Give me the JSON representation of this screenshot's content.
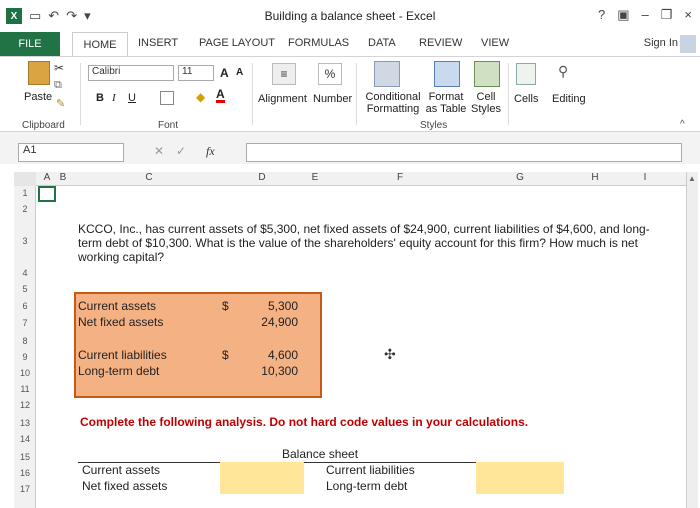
{
  "title": "Building a balance sheet - Excel",
  "window_controls": [
    "?",
    "–",
    "×"
  ],
  "tabs": [
    "FILE",
    "HOME",
    "INSERT",
    "PAGE LAYOUT",
    "FORMULAS",
    "DATA",
    "REVIEW",
    "VIEW"
  ],
  "sign_in": "Sign In",
  "ribbon": {
    "paste": "Paste",
    "font_name": "Calibri",
    "font_size": "11",
    "bold": "B",
    "italic": "I",
    "underline": "U",
    "grow_font": "A",
    "shrink_font": "A",
    "alignment": "Alignment",
    "number": "Number",
    "percent": "%",
    "conditional_formatting": "Conditional Formatting",
    "format_as_table": "Format as Table",
    "cell_styles": "Cell Styles",
    "cells": "Cells",
    "editing": "Editing",
    "group_clipboard": "Clipboard",
    "group_font": "Font",
    "group_styles": "Styles"
  },
  "name_box": "A1",
  "fx": "fx",
  "columns": [
    "A",
    "B",
    "C",
    "D",
    "E",
    "F",
    "G",
    "H",
    "I"
  ],
  "rows": [
    "1",
    "2",
    "3",
    "4",
    "5",
    "6",
    "7",
    "8",
    "9",
    "10",
    "11",
    "12",
    "13",
    "14",
    "15",
    "16",
    "17"
  ],
  "question": "KCCO, Inc., has current assets of $5,300, net fixed assets of $24,900, current liabilities of $4,600, and long-term debt of $10,300. What is the value of the shareholders' equity account for this firm? How much is net working capital?",
  "data_box": {
    "current_assets_label": "Current assets",
    "current_assets_currency": "$",
    "current_assets_value": "5,300",
    "net_fixed_assets_label": "Net fixed assets",
    "net_fixed_assets_value": "24,900",
    "current_liabilities_label": "Current liabilities",
    "current_liabilities_currency": "$",
    "current_liabilities_value": "4,600",
    "long_term_debt_label": "Long-term debt",
    "long_term_debt_value": "10,300"
  },
  "instruction": "Complete the following analysis. Do not hard code values in your calculations.",
  "balance_sheet": {
    "title": "Balance sheet",
    "current_assets": "Current assets",
    "net_fixed_assets": "Net fixed assets",
    "current_liabilities": "Current liabilities",
    "long_term_debt": "Long-term debt"
  },
  "colors": {
    "excel_green": "#217346",
    "orange_fill": "#f4b183",
    "orange_border": "#c55a11",
    "instruction_red": "#c00000",
    "input_yellow": "#ffe699"
  }
}
